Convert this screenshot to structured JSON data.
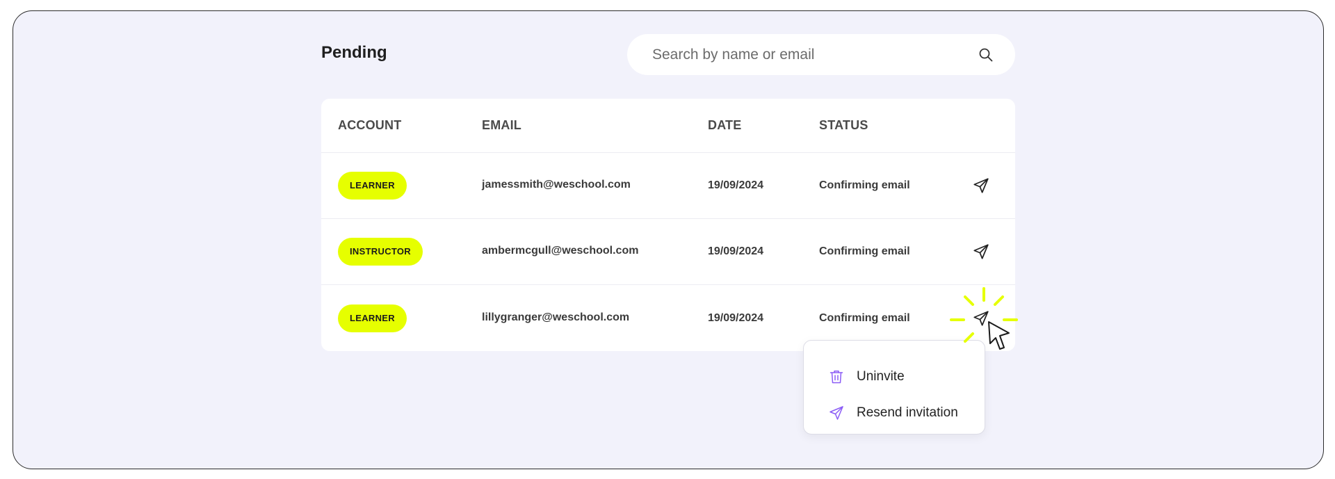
{
  "page": {
    "title": "Pending"
  },
  "search": {
    "placeholder": "Search by name or email",
    "value": ""
  },
  "table": {
    "headers": {
      "account": "ACCOUNT",
      "email": "EMAIL",
      "date": "DATE",
      "status": "STATUS"
    },
    "rows": [
      {
        "account": "LEARNER",
        "email": "jamessmith@weschool.com",
        "date": "19/09/2024",
        "status": "Confirming email"
      },
      {
        "account": "INSTRUCTOR",
        "email": "ambermcgull@weschool.com",
        "date": "19/09/2024",
        "status": "Confirming email"
      },
      {
        "account": "LEARNER",
        "email": "lillygranger@weschool.com",
        "date": "19/09/2024",
        "status": "Confirming email"
      }
    ]
  },
  "menu": {
    "items": [
      {
        "label": "Uninvite",
        "icon": "trash-icon"
      },
      {
        "label": "Resend invitation",
        "icon": "send-icon"
      }
    ]
  },
  "colors": {
    "badge": "#e6ff00",
    "menu_icon": "#8b5cf6",
    "background": "#f2f2fb"
  }
}
